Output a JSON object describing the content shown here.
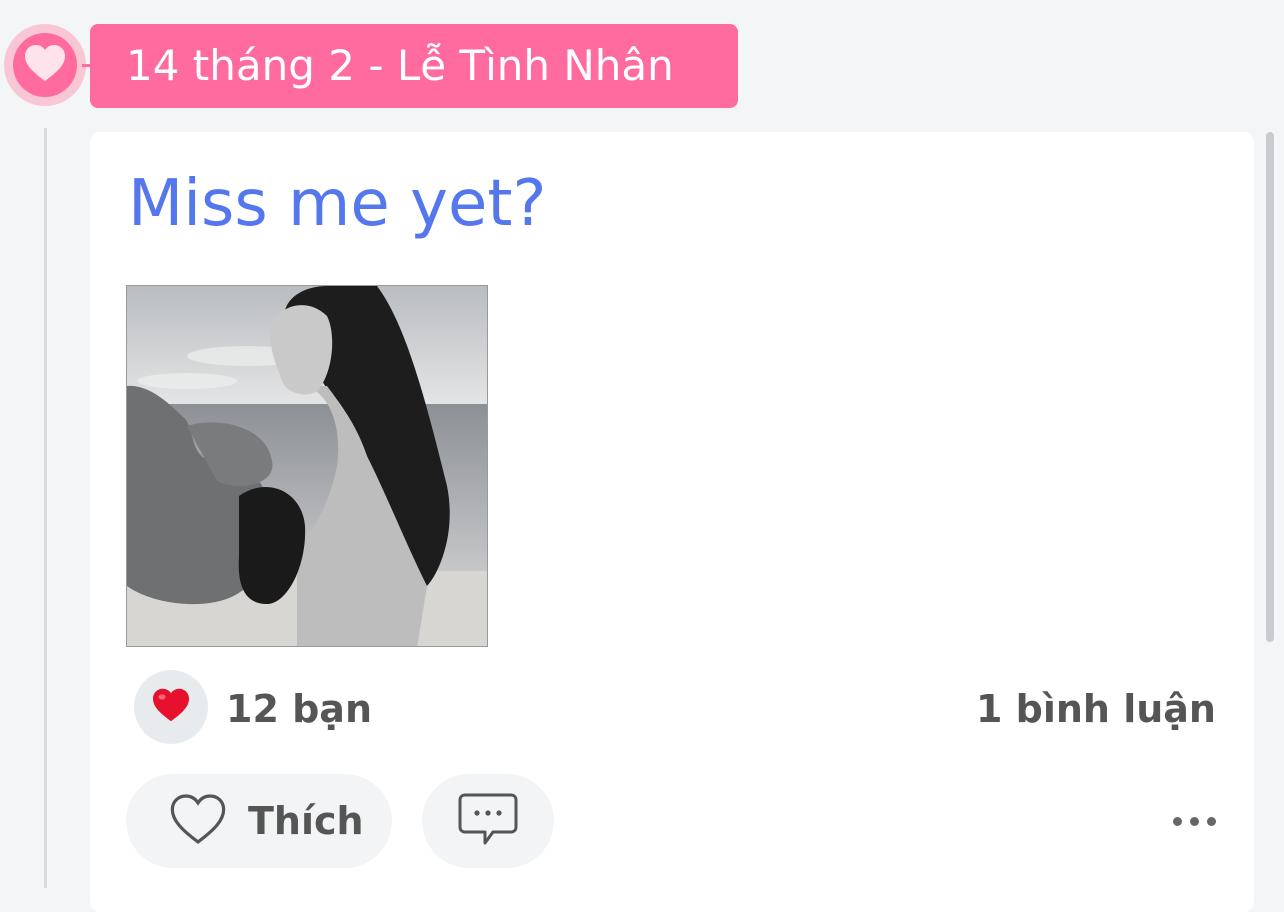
{
  "timeline": {
    "date_label": "14 tháng 2 - Lễ Tình Nhân",
    "icon": "heart-icon"
  },
  "post": {
    "title": "Miss me yet?",
    "photo_alt": "Black and white beach photo",
    "reactions": {
      "icon": "red-heart-emoji",
      "count_label": "12 bạn"
    },
    "comments_label": "1 bình luận",
    "actions": {
      "like_label": "Thích",
      "comment_icon": "comment-icon",
      "more_icon": "more-options-icon"
    }
  },
  "colors": {
    "accent_pink": "#ff6b9e",
    "title_blue": "#5577ee",
    "heart_red": "#e8112d"
  }
}
